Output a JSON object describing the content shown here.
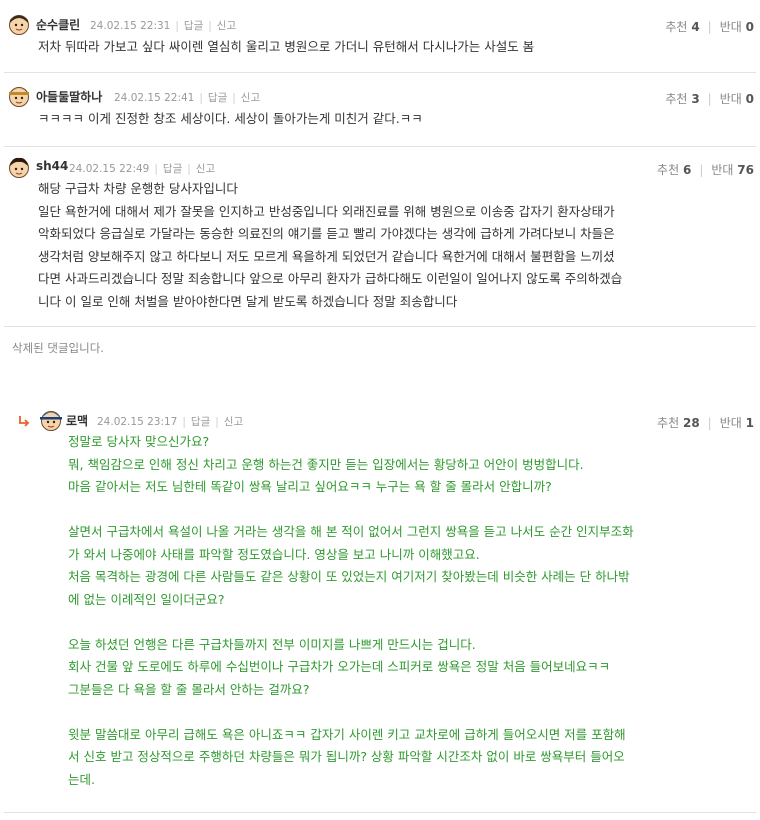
{
  "comments": [
    {
      "author": "순수클린",
      "date": "24.02.15 22:31",
      "reply_label": "답글",
      "report_label": "신고",
      "up_label": "추천",
      "up_count": "4",
      "down_label": "반대",
      "down_count": "0",
      "lines": [
        "저차 뒤따라 가보고 싶다 싸이렌 열심히 울리고 병원으로 가더니 유턴해서 다시나가는 사설도 봄"
      ]
    },
    {
      "author": "아들둘딸하나",
      "date": "24.02.15 22:41",
      "reply_label": "답글",
      "report_label": "신고",
      "up_label": "추천",
      "up_count": "3",
      "down_label": "반대",
      "down_count": "0",
      "lines": [
        "ㅋㅋㅋㅋ 이게 진정한 창조 세상이다. 세상이 돌아가는게 미친거 같다.ㅋㅋ"
      ]
    },
    {
      "author": "sh44",
      "date": "24.02.15 22:49",
      "reply_label": "답글",
      "report_label": "신고",
      "up_label": "추천",
      "up_count": "6",
      "down_label": "반대",
      "down_count": "76",
      "lines": [
        "해당 구급차 차량 운행한 당사자입니다",
        "일단 욕한거에 대해서 제가 잘못을 인지하고 반성중입니다 외래진료를 위해 병원으로 이송중 갑자기 환자상태가",
        "악화되었다 응급실로 가달라는 동승한 의료진의 얘기를 듣고 빨리 가야겠다는 생각에 급하게 가려다보니 차들은",
        "생각처럼 양보해주지 않고 하다보니 저도 모르게 욕을하게 되었던거 같습니다 욕한거에 대해서 불편함을 느끼셨",
        "다면 사과드리겠습니다 정말 죄송합니다 앞으로 아무리 환자가 급하다해도 이런일이 일어나지 않도록 주의하겠습",
        "니다 이 일로 인해 처벌을 받아야한다면 달게 받도록 하겠습니다 정말 죄송합니다"
      ]
    },
    {
      "author": "로맥",
      "date": "24.02.15 23:17",
      "reply_label": "답글",
      "report_label": "신고",
      "up_label": "추천",
      "up_count": "28",
      "down_label": "반대",
      "down_count": "1",
      "lines": [
        "정말로 당사자 맞으신가요?",
        "뭐, 책임감으로 인해 정신 차리고 운행 하는건 좋지만 듣는 입장에서는 황당하고 어안이 벙벙합니다.",
        "마음 같아서는 저도 님한테 똑같이 쌍욕 날리고 싶어요ㅋㅋ 누구는 욕 할 줄 몰라서 안합니까?",
        "",
        "살면서 구급차에서 욕설이 나올 거라는 생각을 해 본 적이 없어서 그런지 쌍욕을 듣고 나서도 순간 인지부조화",
        "가 와서 나중에야 사태를 파악할 정도였습니다. 영상을 보고 나니까 이해했고요.",
        "처음 목격하는 광경에 다른 사람들도 같은 상황이 또 있었는지 여기저기 찾아봤는데 비슷한 사례는 단 하나밖",
        "에 없는 이례적인 일이더군요?",
        "",
        "오늘 하셨던 언행은 다른 구급차들까지 전부 이미지를 나쁘게 만드시는 겁니다.",
        "회사 건물 앞 도로에도 하루에 수십번이나 구급차가 오가는데 스피커로 쌍욕은 정말 처음 들어보네요ㅋㅋ",
        "그분들은 다 욕을 할 줄 몰라서 안하는 걸까요?",
        "",
        "윗분 말씀대로 아무리 급해도 욕은 아니죠ㅋㅋ 갑자기 사이렌 키고 교차로에 급하게 들어오시면 저를 포함해",
        "서 신호 받고 정상적으로 주행하던 차량들은 뭐가 됩니까? 상황 파악할 시간조차 없이 바로 쌍욕부터 들어오",
        "는데."
      ]
    }
  ],
  "deleted_notice": "삭제된 댓글입니다.",
  "colors": {
    "reply_text": "#2f9a2f",
    "reply_arrow": "#e8622c"
  }
}
